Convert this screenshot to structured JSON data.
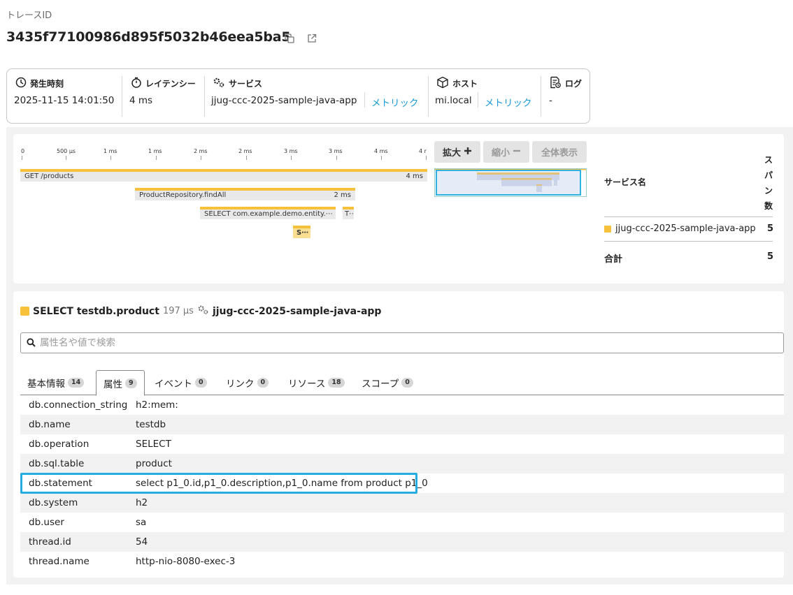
{
  "trace": {
    "label": "トレースID",
    "id": "3435f77100986d895f5032b46eea5ba5"
  },
  "summary": {
    "time_label": "発生時刻",
    "time_value": "2025-11-15 14:01:50",
    "latency_label": "レイテンシー",
    "latency_value": "4 ms",
    "service_label": "サービス",
    "service_value": "jjug-ccc-2025-sample-java-app",
    "service_metric_link": "メトリック",
    "host_label": "ホスト",
    "host_value": "mi.local",
    "host_metric_link": "メトリック",
    "log_label": "ログ",
    "log_value": "-"
  },
  "timeline": {
    "ticks": [
      "0",
      "500 µs",
      "1 ms",
      "1 ms",
      "2 ms",
      "2 ms",
      "3 ms",
      "3 ms",
      "4 ms",
      "4 r"
    ],
    "spans": [
      {
        "name": "GET /products",
        "duration": "4 ms"
      },
      {
        "name": "ProductRepository.findAll",
        "duration": "2 ms"
      },
      {
        "name": "SELECT com.example.demo.entity.⋯",
        "duration": ""
      },
      {
        "name": "T⋯",
        "duration": ""
      },
      {
        "name": "S⋯",
        "duration": ""
      }
    ],
    "zoom_in": "拡大",
    "zoom_out": "縮小",
    "fit_all": "全体表示"
  },
  "services_table": {
    "col_name": "サービス名",
    "col_count": "スパン数",
    "rows": [
      {
        "name": "jjug-ccc-2025-sample-java-app",
        "count": "5"
      }
    ],
    "total_label": "合計",
    "total_count": "5"
  },
  "span_detail": {
    "name": "SELECT testdb.product",
    "duration": "197 µs",
    "service": "jjug-ccc-2025-sample-java-app",
    "search_placeholder": "属性名や値で検索",
    "tabs": [
      {
        "label": "基本情報",
        "count": "14"
      },
      {
        "label": "属性",
        "count": "9"
      },
      {
        "label": "イベント",
        "count": "0"
      },
      {
        "label": "リンク",
        "count": "0"
      },
      {
        "label": "リソース",
        "count": "18"
      },
      {
        "label": "スコープ",
        "count": "0"
      }
    ],
    "attributes": [
      {
        "key": "db.connection_string",
        "value": "h2:mem:"
      },
      {
        "key": "db.name",
        "value": "testdb"
      },
      {
        "key": "db.operation",
        "value": "SELECT"
      },
      {
        "key": "db.sql.table",
        "value": "product"
      },
      {
        "key": "db.statement",
        "value": "select p1_0.id,p1_0.description,p1_0.name from product p1_0"
      },
      {
        "key": "db.system",
        "value": "h2"
      },
      {
        "key": "db.user",
        "value": "sa"
      },
      {
        "key": "thread.id",
        "value": "54"
      },
      {
        "key": "thread.name",
        "value": "http-nio-8080-exec-3"
      }
    ]
  },
  "colors": {
    "span_accent": "#f8c13b",
    "link": "#1a9bd7",
    "highlight": "#25aee1"
  }
}
